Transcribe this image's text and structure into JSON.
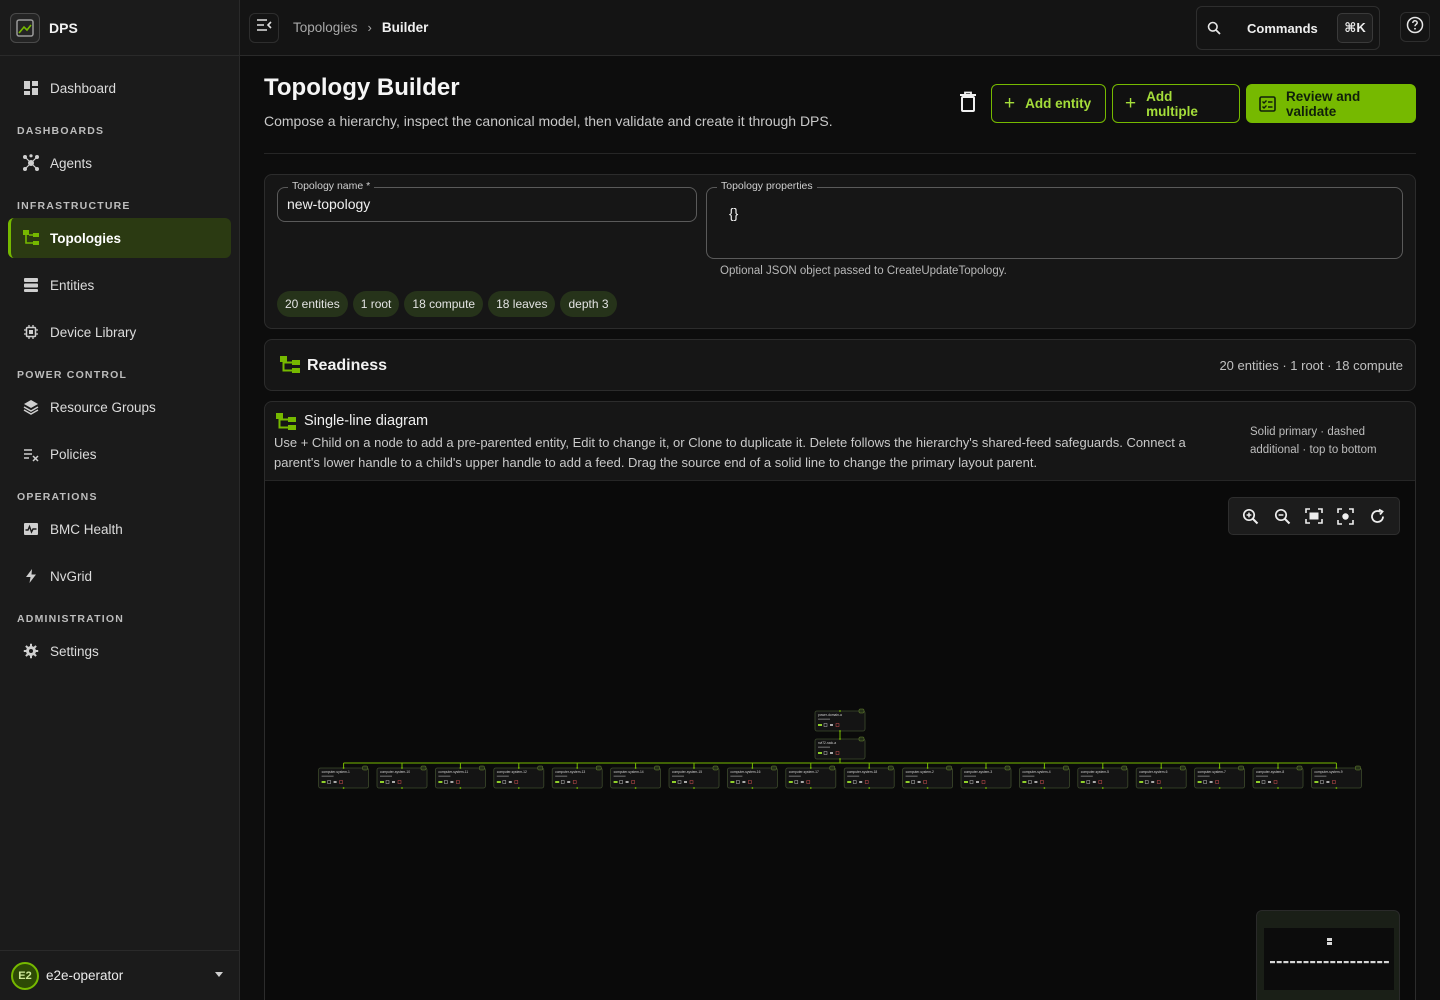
{
  "app": {
    "name": "DPS"
  },
  "sidebar": {
    "dashboard": "Dashboard",
    "sections": {
      "dashboards": "DASHBOARDS",
      "infrastructure": "INFRASTRUCTURE",
      "power_control": "POWER CONTROL",
      "operations": "OPERATIONS",
      "administration": "ADMINISTRATION"
    },
    "items": {
      "agents": "Agents",
      "topologies": "Topologies",
      "entities": "Entities",
      "device_library": "Device Library",
      "resource_groups": "Resource Groups",
      "policies": "Policies",
      "bmc_health": "BMC Health",
      "nvgrid": "NvGrid",
      "settings": "Settings"
    },
    "active": "topologies",
    "user": {
      "initials": "E2",
      "name": "e2e-operator"
    }
  },
  "topbar": {
    "breadcrumbs": [
      "Topologies",
      "Builder"
    ],
    "commands_label": "Commands",
    "commands_shortcut": "⌘K"
  },
  "page": {
    "title": "Topology Builder",
    "subtitle": "Compose a hierarchy, inspect the canonical model, then validate and create it through DPS.",
    "buttons": {
      "add_entity": "Add entity",
      "add_multiple": "Add multiple",
      "review": "Review and validate"
    },
    "accent": "#76b900"
  },
  "form": {
    "name_label": "Topology name *",
    "name_value": "new-topology",
    "props_label": "Topology properties",
    "props_value": "{}",
    "props_helper": "Optional JSON object passed to CreateUpdateTopology.",
    "chips": [
      "20 entities",
      "1 root",
      "18 compute",
      "18 leaves",
      "depth 3"
    ]
  },
  "readiness": {
    "title": "Readiness",
    "meta": "20 entities · 1 root · 18 compute"
  },
  "diagram": {
    "title": "Single-line diagram",
    "description": "Use + Child on a node to add a pre-parented entity, Edit to change it, or Clone to duplicate it. Delete follows the hierarchy's shared-feed safeguards. Connect a parent's lower handle to a child's upper handle to add a feed. Drag the source end of a solid line to change the primary layout parent.",
    "legend": "Solid primary · dashed additional · top to bottom",
    "root_node": "power-domain-a",
    "mid_node": "nvl72-rack-a",
    "leaf_nodes": [
      "computer-system-1",
      "computer-system-10",
      "computer-system-11",
      "computer-system-12",
      "computer-system-13",
      "computer-system-14",
      "computer-system-15",
      "computer-system-16",
      "computer-system-17",
      "computer-system-18",
      "computer-system-2",
      "computer-system-3",
      "computer-system-4",
      "computer-system-5",
      "computer-system-6",
      "computer-system-7",
      "computer-system-8",
      "computer-system-9"
    ],
    "zoom_controls": [
      "zoom-in",
      "zoom-out",
      "fit-view",
      "focus",
      "reset"
    ]
  }
}
